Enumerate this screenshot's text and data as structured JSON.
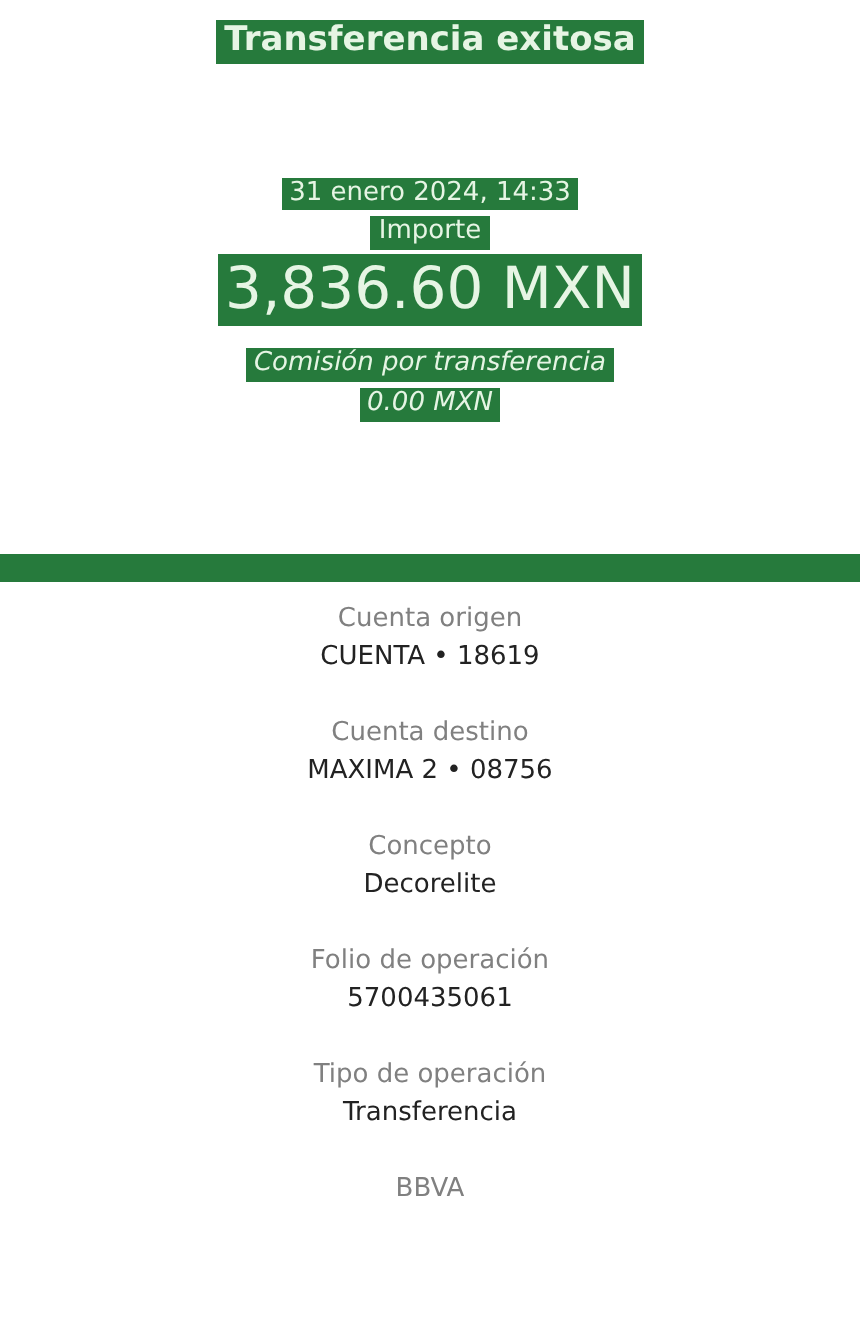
{
  "header": {
    "title": "Transferencia exitosa",
    "date": "31 enero 2024, 14:33",
    "amount_label": "Importe",
    "amount": "3,836.60 MXN",
    "fee_label": "Comisión por transferencia",
    "fee": "0.00 MXN"
  },
  "details": [
    {
      "label": "Cuenta origen",
      "value": "CUENTA • 18619"
    },
    {
      "label": "Cuenta destino",
      "value": "MAXIMA 2 • 08756"
    },
    {
      "label": "Concepto",
      "value": "Decorelite"
    },
    {
      "label": "Folio de operación",
      "value": "5700435061"
    },
    {
      "label": "Tipo de operación",
      "value": "Transferencia"
    },
    {
      "label": "BBVA"
    }
  ]
}
